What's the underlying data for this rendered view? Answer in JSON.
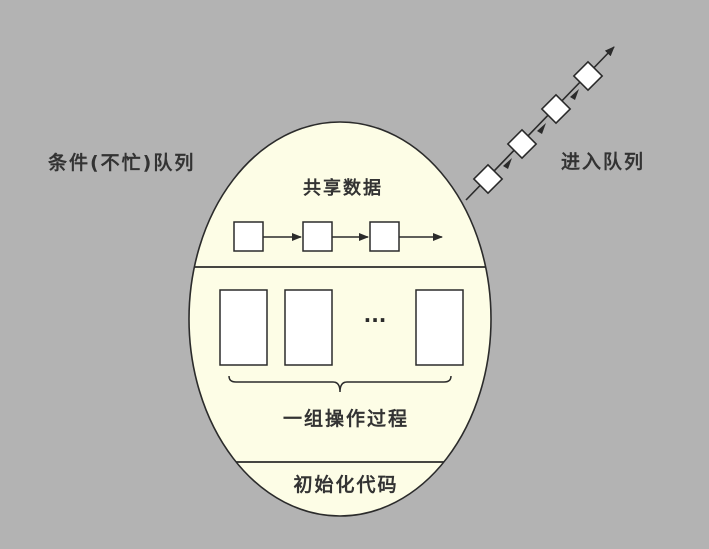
{
  "diagram": {
    "condition_queue_label": "条件(不忙)队列",
    "entry_queue_label": "进入队列",
    "shared_data_label": "共享数据",
    "operations_label": "一组操作过程",
    "ellipsis": "···",
    "init_code_label": "初始化代码"
  },
  "colors": {
    "background": "#b3b3b3",
    "monitor_fill": "#fdfde6",
    "stroke": "#2b2b2b",
    "box_fill": "#ffffff",
    "text": "#333333"
  }
}
